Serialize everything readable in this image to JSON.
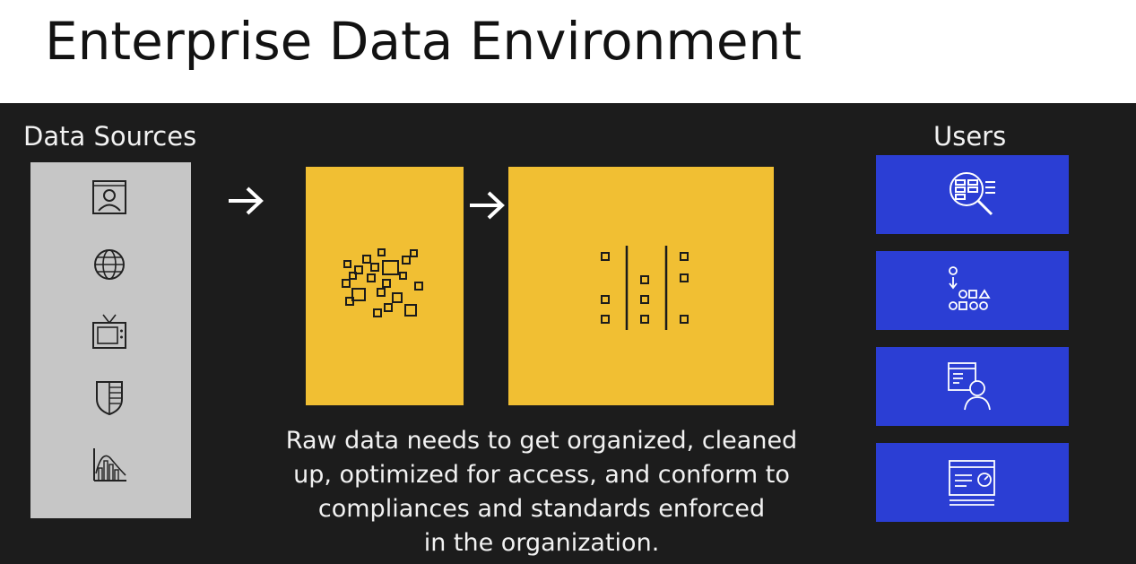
{
  "title": "Enterprise Data Environment",
  "data_sources": {
    "heading": "Data Sources",
    "icons": [
      "user-profile-icon",
      "globe-icon",
      "television-icon",
      "document-shield-icon",
      "analytics-chart-icon"
    ]
  },
  "pipeline": {
    "stages": [
      {
        "id": "raw-data",
        "icon": "scattered-data-points-icon"
      },
      {
        "id": "organized-data",
        "icon": "organized-data-columns-icon"
      }
    ],
    "arrow_icon": "right-arrow-icon"
  },
  "users": {
    "heading": "Users",
    "icons": [
      "data-search-icon",
      "data-transformation-icon",
      "user-report-icon",
      "dashboard-window-icon"
    ]
  },
  "caption": {
    "lines": [
      "Raw data needs to get organized, cleaned",
      "up, optimized for access, and conform to",
      "compliances and standards enforced",
      "in the organization."
    ]
  },
  "colors": {
    "title_bar": "#ffffff",
    "background": "#1c1c1c",
    "sources_panel": "#c6c6c6",
    "stage_fill": "#f1bf33",
    "user_card": "#2b3ed4",
    "text_light": "#f2f2f2"
  }
}
